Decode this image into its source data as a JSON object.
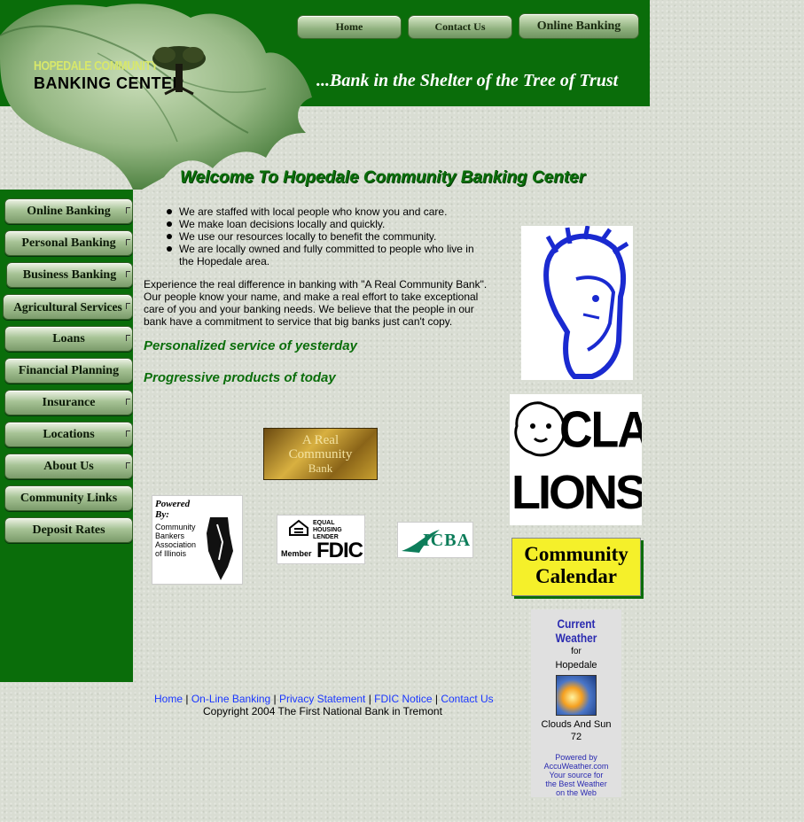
{
  "logo": {
    "line1": "HOPEDALE COMMUNITY",
    "line2": "BANKING CENTER"
  },
  "top_nav": [
    "Home",
    "Contact Us",
    "Online Banking"
  ],
  "tagline": "...Bank in the Shelter of the Tree of Trust",
  "welcome": "Welcome To Hopedale Community Banking Center",
  "sidebar": [
    {
      "label": "Online Banking"
    },
    {
      "label": "Personal Banking"
    },
    {
      "label": "Business Banking"
    },
    {
      "label": "Agricultural Services"
    },
    {
      "label": "Loans"
    },
    {
      "label": "Financial Planning"
    },
    {
      "label": "Insurance"
    },
    {
      "label": "Locations"
    },
    {
      "label": "About Us"
    },
    {
      "label": "Community Links"
    },
    {
      "label": "Deposit Rates"
    }
  ],
  "bullets": [
    "We are staffed with local people who know you and care.",
    "We make loan decisions locally and quickly.",
    "We use our resources locally to benefit the community.",
    "We are locally owned and fully committed to people who live in the Hopedale area."
  ],
  "paragraph": "Experience the real difference in banking with \"A Real Community Bank\". Our people know your name, and make a real effort to take exceptional care of you and your banking needs. We believe that the people in our bank have a commitment to service that big banks just can't copy.",
  "slogan1": "Personalized service of yesterday",
  "slogan2": "Progressive products of today",
  "badges": {
    "real_community": [
      "A Real",
      "Community",
      "Bank"
    ],
    "cbai": [
      "Powered",
      "By:",
      "Community",
      "Bankers",
      "Association",
      "of Illinois"
    ],
    "fdic": {
      "equal_housing": [
        "EQUAL HOUSING",
        "LENDER"
      ],
      "member": "Member",
      "fdic": "FDIC"
    },
    "icba": "ICBA",
    "lions": [
      "CLA",
      "LIONS"
    ],
    "calendar": [
      "Community",
      "Calendar"
    ]
  },
  "weather": {
    "title": [
      "Current",
      "Weather"
    ],
    "for": "for",
    "place": "Hopedale",
    "condition": "Clouds And Sun",
    "temp": "72",
    "powered": [
      "Powered by",
      "AccuWeather.com",
      "Your source for",
      "the Best Weather",
      "on the Web"
    ]
  },
  "footer": {
    "links": [
      "Home",
      "On-Line Banking",
      "Privacy Statement",
      "FDIC Notice",
      "Contact Us"
    ],
    "copyright": "Copyright 2004 The First National Bank in Tremont"
  },
  "colors": {
    "green": "#0a6d0a",
    "link": "#1a37ff"
  }
}
